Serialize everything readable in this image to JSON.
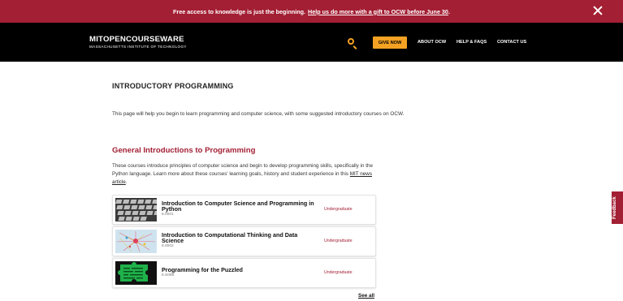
{
  "banner": {
    "text": "Free access to knowledge is just the beginning.",
    "link": "Help us do more with a gift to OCW before June 30",
    "suffix": "."
  },
  "header": {
    "logo_mit": "MIT",
    "logo_ocw": "OPENCOURSEWARE",
    "logo_sub": "MASSACHUSETTS INSTITUTE OF TECHNOLOGY",
    "give_now": "GIVE NOW",
    "nav": [
      "ABOUT OCW",
      "HELP & FAQS",
      "CONTACT US"
    ],
    "search_icon": "search-icon",
    "accent": "#f4a223"
  },
  "page": {
    "title": "INTRODUCTORY PROGRAMMING",
    "intro": "This page will help you begin to learn programming and computer science, with some suggested introductory courses on OCW."
  },
  "section": {
    "title": "General Introductions to Programming",
    "text": "These courses introduce principles of computer science and begin to develop programming skills, specifically in the Python language. Learn more about these courses' learning goals, history and student experience in this",
    "link": "MIT news article",
    "suffix": ".",
    "color": "#a31f34"
  },
  "courses": [
    {
      "title": "Introduction to Computer Science and Programming in Python",
      "number": "6.0001",
      "level": "Undergraduate",
      "thumb": "keyboard-image"
    },
    {
      "title": "Introduction to Computational Thinking and Data Science",
      "number": "6.0002",
      "level": "Undergraduate",
      "thumb": "network-graph-image"
    },
    {
      "title": "Programming for the Puzzled",
      "number": "6.S095",
      "level": "Undergraduate",
      "thumb": "puzzle-piece-image"
    }
  ],
  "see_all": "See all",
  "feedback": "Feedback"
}
